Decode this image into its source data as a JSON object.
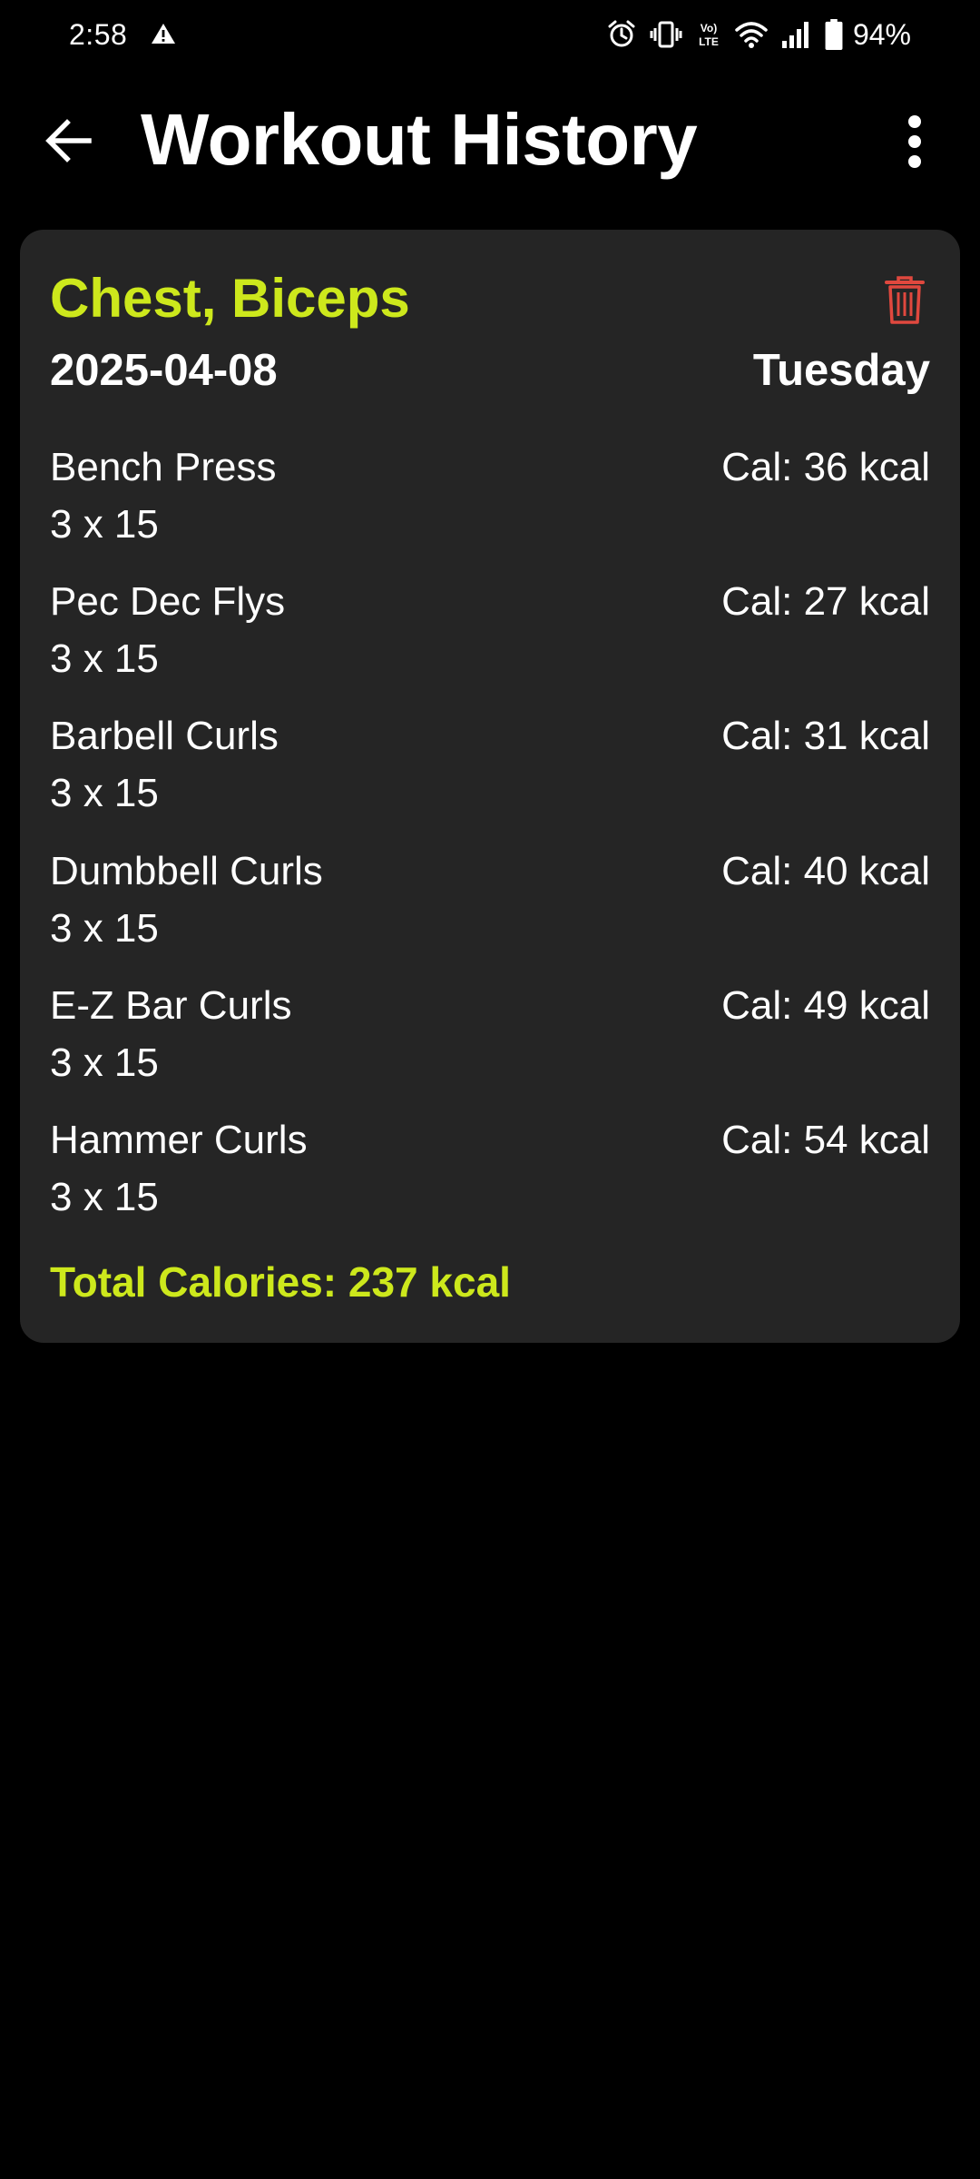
{
  "status_bar": {
    "time": "2:58",
    "battery": "94%",
    "icons": [
      "alert-icon",
      "alarm-icon",
      "vibrate-icon",
      "volte-icon",
      "wifi-icon",
      "signal-icon",
      "battery-icon"
    ]
  },
  "app_bar": {
    "title": "Workout History",
    "back_icon": "arrow-back-icon",
    "menu_icon": "more-vert-icon"
  },
  "workout": {
    "title": "Chest, Biceps",
    "date": "2025-04-08",
    "day": "Tuesday",
    "exercises": [
      {
        "name": "Bench Press",
        "sets": "3 x 15",
        "calories": "Cal: 36 kcal"
      },
      {
        "name": "Pec Dec Flys",
        "sets": "3 x 15",
        "calories": "Cal: 27 kcal"
      },
      {
        "name": "Barbell Curls",
        "sets": "3 x 15",
        "calories": "Cal: 31 kcal"
      },
      {
        "name": "Dumbbell Curls",
        "sets": "3 x 15",
        "calories": "Cal: 40 kcal"
      },
      {
        "name": "E-Z Bar Curls",
        "sets": "3 x 15",
        "calories": "Cal: 49 kcal"
      },
      {
        "name": "Hammer Curls",
        "sets": "3 x 15",
        "calories": "Cal: 54 kcal"
      }
    ],
    "total": "Total Calories: 237 kcal",
    "delete_icon": "trash-icon"
  },
  "colors": {
    "background": "#000000",
    "card": "#252525",
    "accent": "#cde81c",
    "delete": "#e0483e",
    "text": "#ffffff"
  }
}
